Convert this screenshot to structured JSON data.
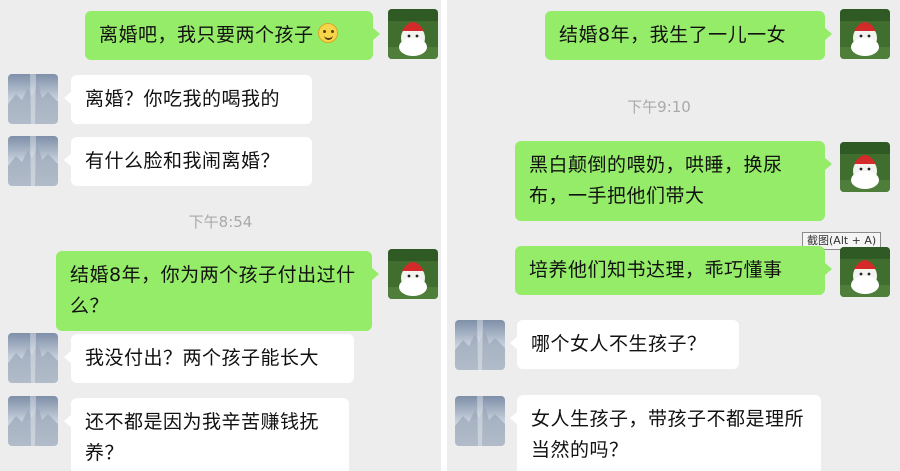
{
  "left": {
    "messages": [
      {
        "text": "离婚吧，我只要两个孩子"
      },
      {
        "text": "离婚？你吃我的喝我的"
      },
      {
        "text": "有什么脸和我闹离婚？"
      },
      {
        "text": "结婚8年，你为两个孩子付出过什么？"
      },
      {
        "text": "我没付出？两个孩子能长大"
      },
      {
        "text": "还不都是因为我辛苦赚钱抚养？"
      }
    ],
    "timestamp": "下午8:54"
  },
  "right": {
    "messages": [
      {
        "text": "结婚8年，我生了一儿一女"
      },
      {
        "text": "黑白颠倒的喂奶，哄睡，换尿布，一手把他们带大"
      },
      {
        "text": "培养他们知书达理，乖巧懂事"
      },
      {
        "text": "哪个女人不生孩子？"
      },
      {
        "text": "女人生孩子，带孩子不都是理所当然的吗？"
      }
    ],
    "timestamp": "下午9:10",
    "tooltip": "截图(Alt + A)"
  },
  "colors": {
    "background": "#ededed",
    "sent_bubble": "#95ec69",
    "received_bubble": "#ffffff",
    "timestamp": "#a9a9a9"
  },
  "icons": {
    "my_avatar": "cartoon-avatar-icon",
    "other_avatar": "sky-photo-avatar-icon",
    "emoji": "smile-emoji-icon"
  }
}
